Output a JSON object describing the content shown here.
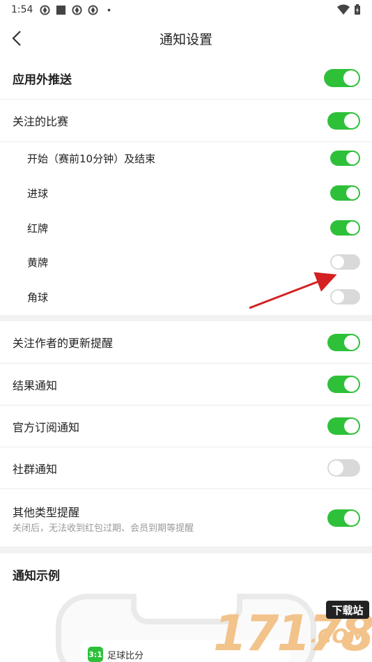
{
  "status_bar": {
    "time": "1:54"
  },
  "header": {
    "title": "通知设置"
  },
  "settings": {
    "push": {
      "label": "应用外推送",
      "on": true
    },
    "followed_matches": {
      "label": "关注的比赛",
      "on": true
    },
    "match_items": [
      {
        "label": "开始（赛前10分钟）及结束",
        "on": true
      },
      {
        "label": "进球",
        "on": true
      },
      {
        "label": "红牌",
        "on": true
      },
      {
        "label": "黄牌",
        "on": false
      },
      {
        "label": "角球",
        "on": false
      }
    ],
    "other_items": [
      {
        "label": "关注作者的更新提醒",
        "on": true
      },
      {
        "label": "结果通知",
        "on": true
      },
      {
        "label": "官方订阅通知",
        "on": true
      },
      {
        "label": "社群通知",
        "on": false
      }
    ],
    "other_types": {
      "label": "其他类型提醒",
      "description": "关闭后，无法收到红包过期、会员到期等提醒",
      "on": true
    }
  },
  "example": {
    "title": "通知示例",
    "app_icon_text": "3:1",
    "app_name": "足球比分"
  },
  "watermark": {
    "number": "17178",
    "badge": "下载站",
    "domain": ".COM"
  },
  "colors": {
    "toggle_on": "#2fc03a",
    "toggle_off": "#d9d9d9",
    "arrow": "#d42020"
  }
}
